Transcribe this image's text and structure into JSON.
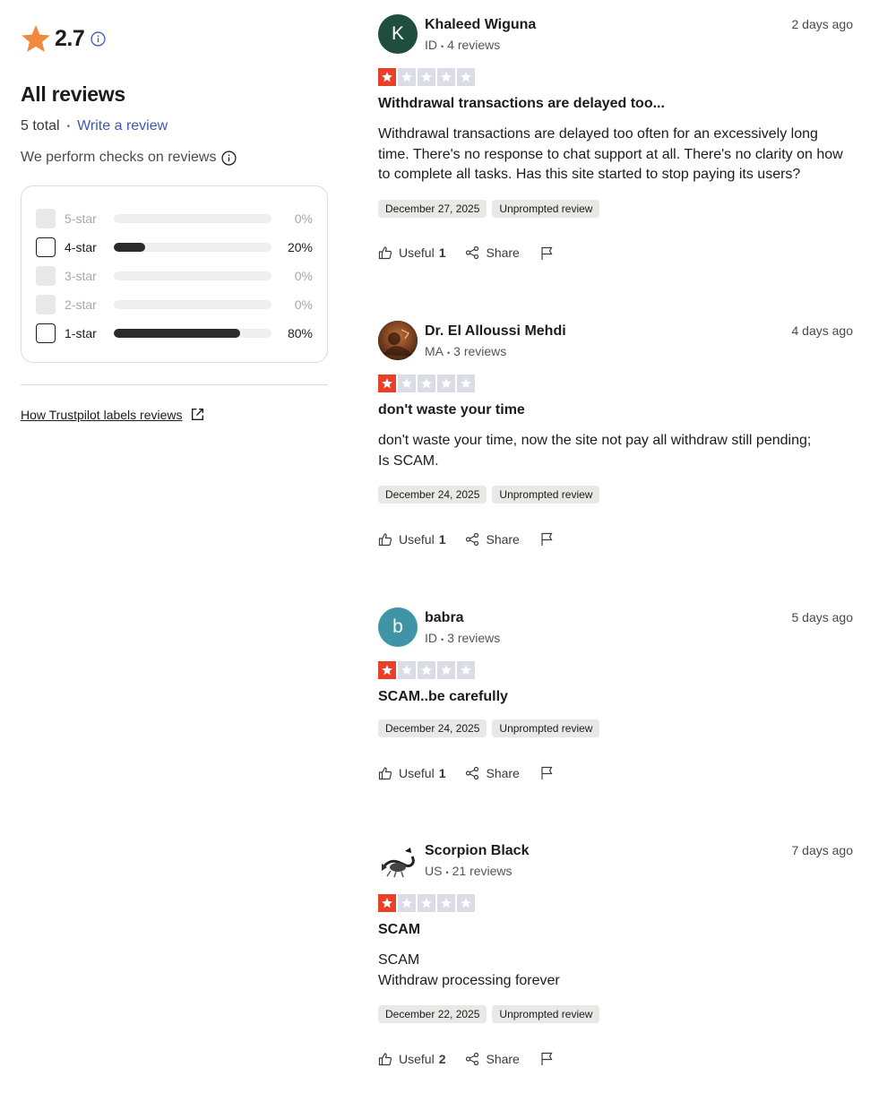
{
  "summary": {
    "rating": "2.7",
    "star_color": "#f0883e",
    "heading": "All reviews",
    "total": "5 total",
    "write_review": "Write a review",
    "checks_text": "We perform checks on reviews",
    "distribution": [
      {
        "label": "5-star",
        "percent": "0%",
        "fill": 0,
        "enabled": false
      },
      {
        "label": "4-star",
        "percent": "20%",
        "fill": 20,
        "enabled": true
      },
      {
        "label": "3-star",
        "percent": "0%",
        "fill": 0,
        "enabled": false
      },
      {
        "label": "2-star",
        "percent": "0%",
        "fill": 0,
        "enabled": false
      },
      {
        "label": "1-star",
        "percent": "80%",
        "fill": 80,
        "enabled": true
      }
    ],
    "labels_link": "How Trustpilot labels reviews"
  },
  "reviews": [
    {
      "initial": "K",
      "avatar_color": "#1f4e3d",
      "name": "Khaleed Wiguna",
      "country": "ID",
      "reviews_count": "4 reviews",
      "ago": "2 days ago",
      "stars": 1,
      "title": "Withdrawal transactions are delayed too...",
      "body": "Withdrawal transactions are delayed too often for an excessively long time. There's no response to chat support at all. There's no clarity on how to complete all tasks. Has this site started to stop paying its users?",
      "date": "December 27, 2025",
      "label": "Unprompted review",
      "useful": "Useful",
      "useful_count": "1",
      "share": "Share"
    },
    {
      "initial": "",
      "avatar_color": "#6b3a22",
      "name": "Dr. El Alloussi Mehdi",
      "country": "MA",
      "reviews_count": "3 reviews",
      "ago": "4 days ago",
      "stars": 1,
      "title": "don't waste your time",
      "body": "don't waste your time, now the site not pay all withdraw still pending;\nIs SCAM.",
      "date": "December 24, 2025",
      "label": "Unprompted review",
      "useful": "Useful",
      "useful_count": "1",
      "share": "Share"
    },
    {
      "initial": "b",
      "avatar_color": "#3f95a5",
      "name": "babra",
      "country": "ID",
      "reviews_count": "3 reviews",
      "ago": "5 days ago",
      "stars": 1,
      "title": "SCAM..be carefully",
      "body": "",
      "date": "December 24, 2025",
      "label": "Unprompted review",
      "useful": "Useful",
      "useful_count": "1",
      "share": "Share"
    },
    {
      "initial": "",
      "avatar_color": "#ffffff",
      "name": "Scorpion Black",
      "country": "US",
      "reviews_count": "21 reviews",
      "ago": "7 days ago",
      "stars": 1,
      "title": "SCAM",
      "body": "SCAM\nWithdraw processing forever",
      "date": "December 22, 2025",
      "label": "Unprompted review",
      "useful": "Useful",
      "useful_count": "2",
      "share": "Share"
    }
  ]
}
